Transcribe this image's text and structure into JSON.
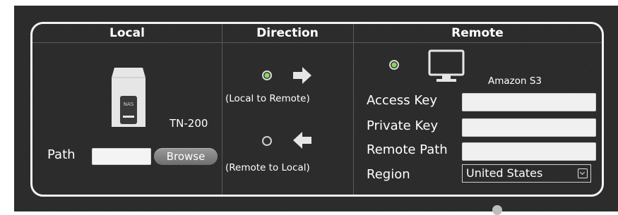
{
  "headers": {
    "local": "Local",
    "direction": "Direction",
    "remote": "Remote"
  },
  "local": {
    "device_icon": "nas-icon",
    "device_badge": "NAS",
    "device_name": "TN-200",
    "path_label": "Path",
    "path_value": "",
    "browse_label": "Browse"
  },
  "direction": {
    "options": [
      {
        "label": "(Local to Remote)",
        "selected": true,
        "icon": "arrow-right-icon"
      },
      {
        "label": "(Remote to Local)",
        "selected": false,
        "icon": "arrow-left-icon"
      }
    ]
  },
  "remote": {
    "radio_selected": true,
    "service_icon": "monitor-icon",
    "service_name": "Amazon S3",
    "access_key_label": "Access Key",
    "access_key_value": "",
    "private_key_label": "Private Key",
    "private_key_value": "",
    "remote_path_label": "Remote Path",
    "remote_path_value": "",
    "region_label": "Region",
    "region_value": "United States"
  },
  "colors": {
    "background": "#2b2b2b",
    "border": "#f2f2f2",
    "radio_on": "#8ad85a",
    "text": "#ffffff"
  }
}
